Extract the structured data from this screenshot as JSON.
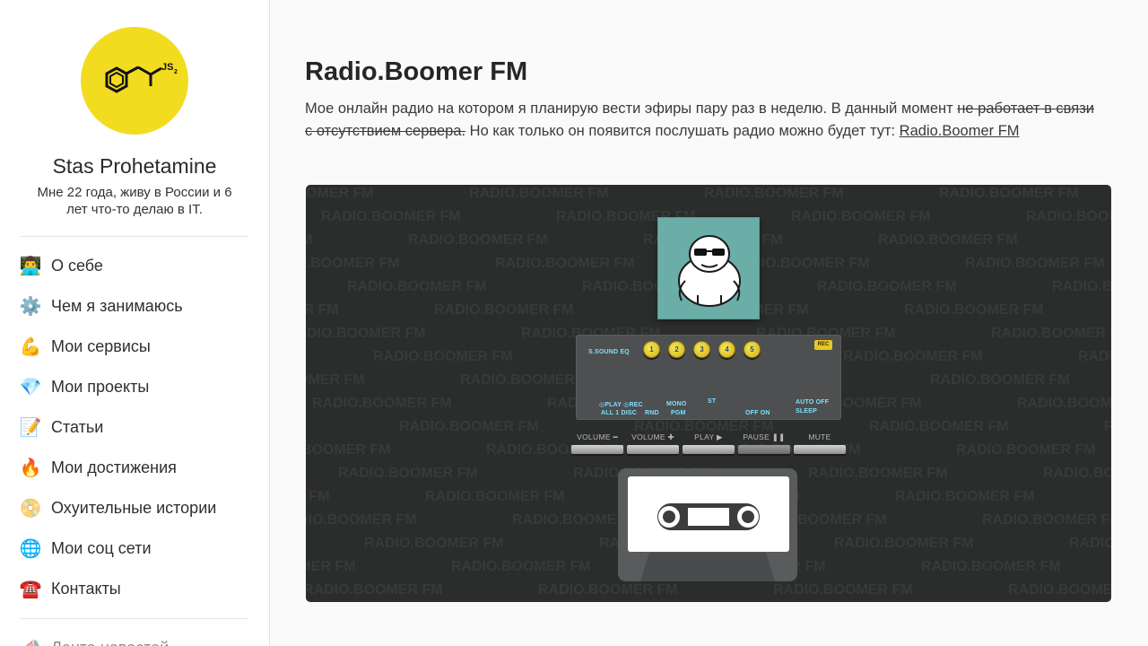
{
  "sidebar": {
    "logo_text": "JS2",
    "profile_name": "Stas Prohetamine",
    "profile_bio": "Мне 22 года, живу в России и 6 лет что-то делаю в IT.",
    "nav": [
      {
        "emoji": "👨‍💻",
        "label": "О себе"
      },
      {
        "emoji": "⚙️",
        "label": "Чем я занимаюсь"
      },
      {
        "emoji": "💪",
        "label": "Мои сервисы"
      },
      {
        "emoji": "💎",
        "label": "Мои проекты"
      },
      {
        "emoji": "📝",
        "label": "Статьи"
      },
      {
        "emoji": "🔥",
        "label": "Мои достижения"
      },
      {
        "emoji": "📀",
        "label": "Охуительные истории"
      },
      {
        "emoji": "🌐",
        "label": "Мои соц сети"
      },
      {
        "emoji": "☎️",
        "label": "Контакты"
      }
    ],
    "extra_item": {
      "emoji": "📣",
      "label": "Лента новостей"
    }
  },
  "main": {
    "title": "Radio.Boomer FM",
    "text_before": "Мое онлайн радио на котором я планирую вести эфиры пару раз в неделю. В данный момент ",
    "text_strike": "не работает в связи с отсутствием сервера.",
    "text_after": " Но как только он появится послушать радио можно будет тут: ",
    "link_text": "Radio.Boomer FM"
  },
  "player": {
    "watermark": "RADIO.BOOMER FM",
    "eq_label": "S.SOUND EQ",
    "presets": [
      "1",
      "2",
      "3",
      "4",
      "5"
    ],
    "rec_label": "REC",
    "indicators": {
      "play_rec": "◎PLAY ◎REC",
      "all_disc": "ALL 1 DISC",
      "rnd": "RND",
      "mono": "MONO",
      "pgm": "PGM",
      "st": "ST",
      "off_on": "OFF ON",
      "auto_off": "AUTO OFF",
      "sleep": "SLEEP"
    },
    "buttons": [
      {
        "label": "VOLUME ━"
      },
      {
        "label": "VOLUME ✚"
      },
      {
        "label": "PLAY ▶"
      },
      {
        "label": "PAUSE ❚❚"
      },
      {
        "label": "MUTE"
      }
    ],
    "colors": {
      "background": "#2b2c2c",
      "cover": "#6aaea7",
      "accent_yellow": "#f2dc1f",
      "indicator_cyan": "#7de0ff"
    }
  }
}
